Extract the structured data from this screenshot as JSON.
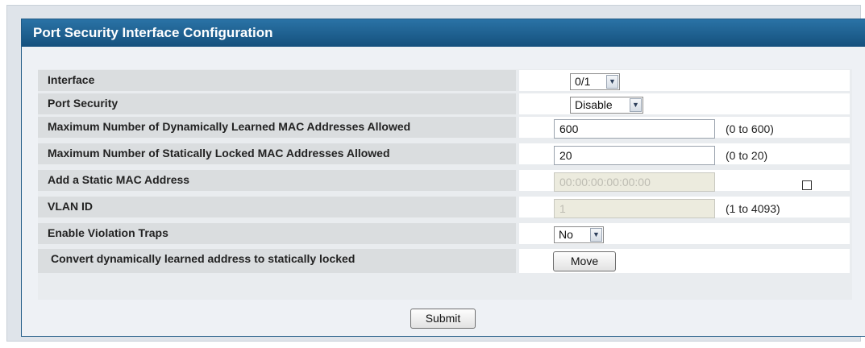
{
  "panel": {
    "title": "Port Security Interface Configuration"
  },
  "rows": [
    {
      "label": "Interface",
      "select_value": "0/1"
    },
    {
      "label": "Port Security",
      "select_value": "Disable"
    },
    {
      "label": "Maximum Number of Dynamically Learned MAC Addresses Allowed",
      "input_value": "600",
      "range": "(0 to 600)"
    },
    {
      "label": "Maximum Number of Statically Locked MAC Addresses Allowed",
      "input_value": "20",
      "range": "(0 to 20)"
    },
    {
      "label": "Add a Static MAC Address",
      "input_value": "00:00:00:00:00:00"
    },
    {
      "label": "VLAN ID",
      "input_value": "1",
      "range": "(1 to 4093)"
    },
    {
      "label": "Enable Violation Traps",
      "select_value": "No"
    },
    {
      "label": "Convert dynamically learned address to statically locked",
      "button_label": "Move"
    }
  ],
  "footer": {
    "submit_label": "Submit"
  },
  "icons": {
    "dropdown": "chevron-down-icon"
  }
}
